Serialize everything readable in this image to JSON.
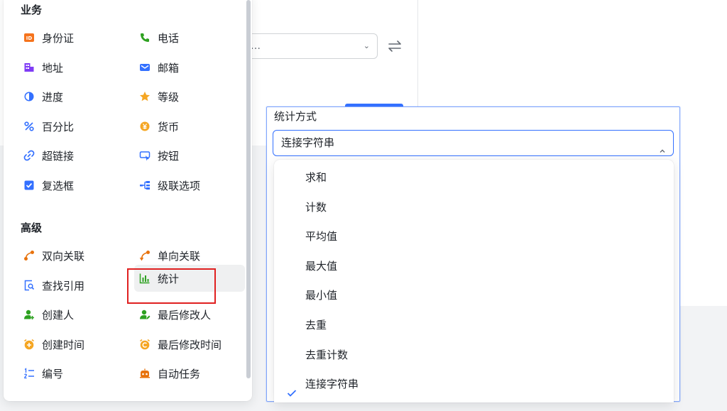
{
  "background": {
    "select_value": "…"
  },
  "field_panel": {
    "sections": [
      {
        "title": "业务",
        "items": [
          {
            "label": "身份证",
            "icon": "id-card-icon"
          },
          {
            "label": "电话",
            "icon": "phone-icon"
          },
          {
            "label": "地址",
            "icon": "address-icon"
          },
          {
            "label": "邮箱",
            "icon": "mail-icon"
          },
          {
            "label": "进度",
            "icon": "progress-icon"
          },
          {
            "label": "等级",
            "icon": "star-icon"
          },
          {
            "label": "百分比",
            "icon": "percent-icon"
          },
          {
            "label": "货币",
            "icon": "currency-icon"
          },
          {
            "label": "超链接",
            "icon": "link-icon"
          },
          {
            "label": "按钮",
            "icon": "button-icon"
          },
          {
            "label": "复选框",
            "icon": "checkbox-icon"
          },
          {
            "label": "级联选项",
            "icon": "cascade-icon"
          }
        ]
      },
      {
        "title": "高级",
        "items": [
          {
            "label": "双向关联",
            "icon": "two-way-link-icon"
          },
          {
            "label": "单向关联",
            "icon": "one-way-link-icon"
          },
          {
            "label": "查找引用",
            "icon": "lookup-icon"
          },
          {
            "label": "统计",
            "icon": "chart-icon"
          },
          {
            "label": "创建人",
            "icon": "creator-icon"
          },
          {
            "label": "最后修改人",
            "icon": "modifier-icon"
          },
          {
            "label": "创建时间",
            "icon": "created-time-icon"
          },
          {
            "label": "最后修改时间",
            "icon": "modified-time-icon"
          },
          {
            "label": "编号",
            "icon": "numbering-icon"
          },
          {
            "label": "自动任务",
            "icon": "automation-icon"
          }
        ]
      }
    ]
  },
  "config": {
    "label": "统计方式",
    "selected": "连接字符串",
    "options": [
      "求和",
      "计数",
      "平均值",
      "最大值",
      "最小值",
      "去重",
      "去重计数",
      "连接字符串"
    ]
  },
  "colors": {
    "accent": "#3370ff",
    "highlight_border": "#e02020"
  }
}
